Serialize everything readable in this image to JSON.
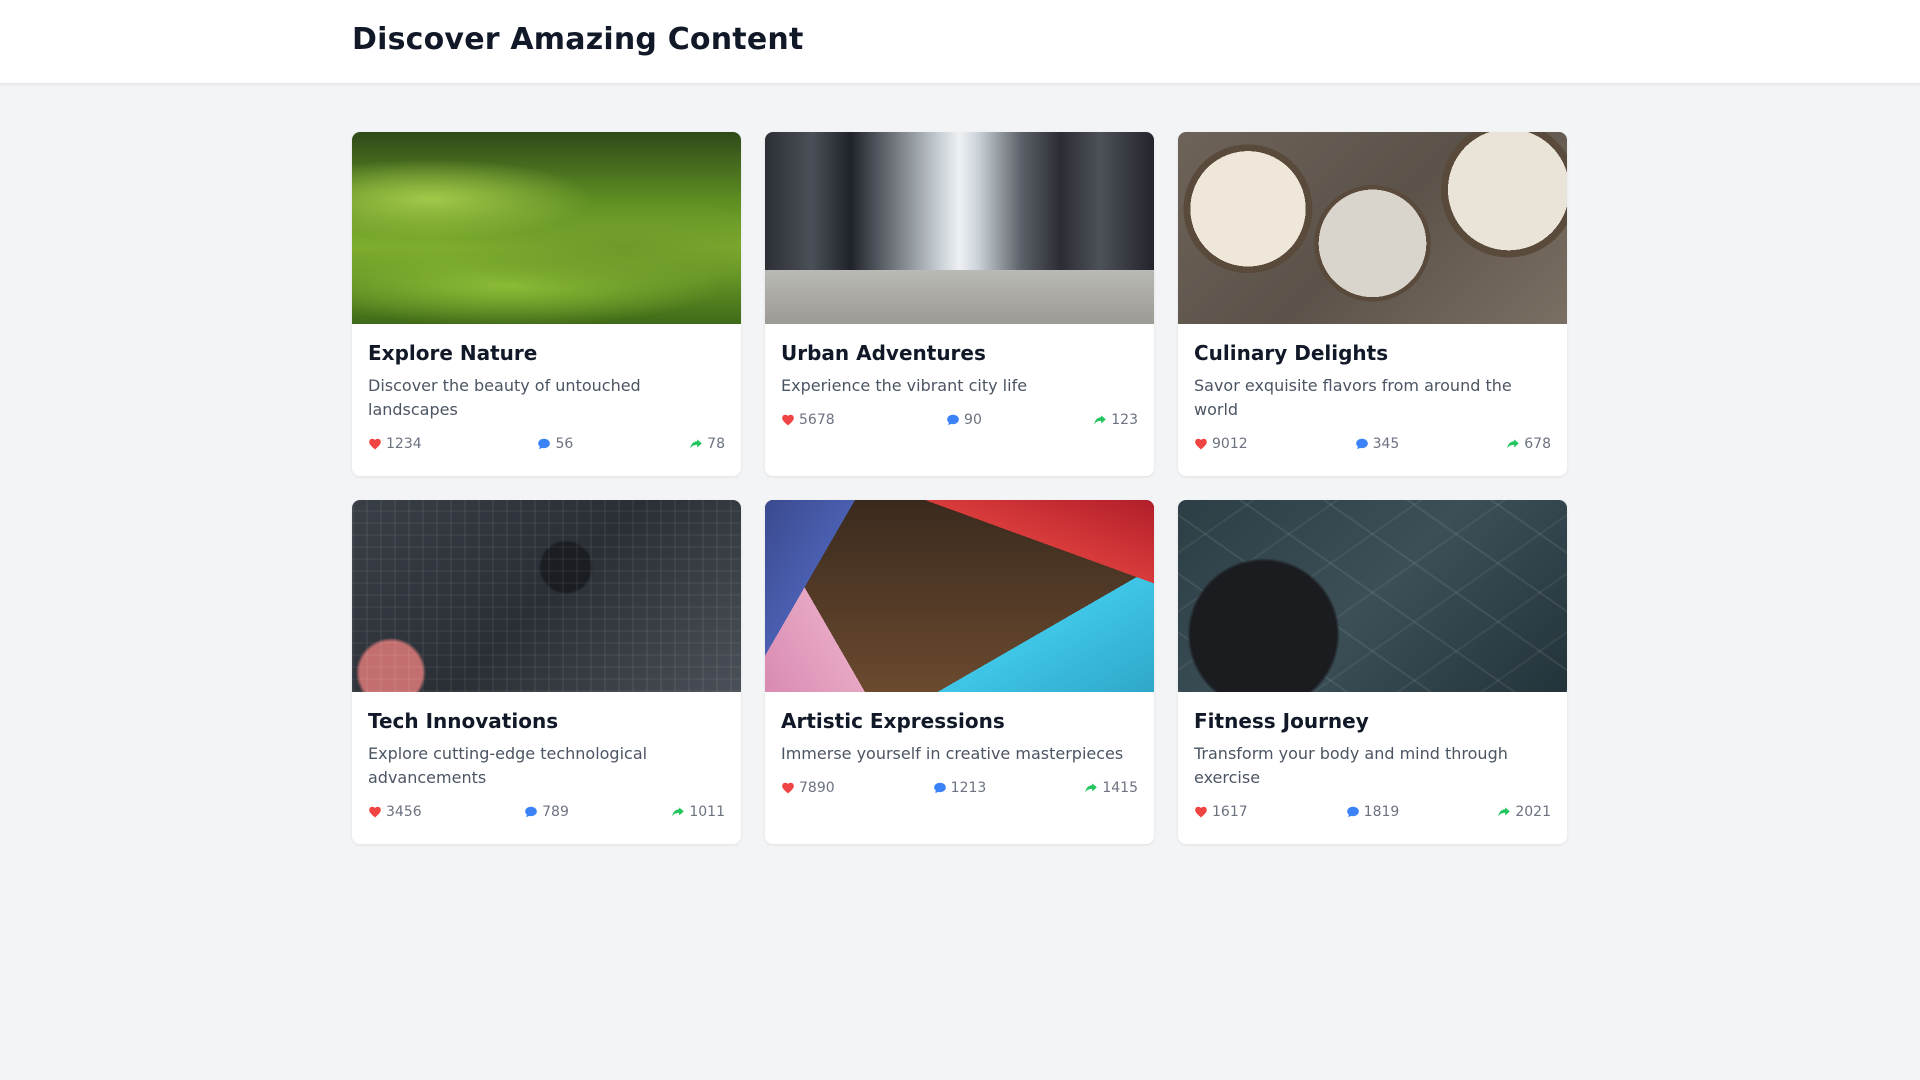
{
  "header": {
    "title": "Discover Amazing Content"
  },
  "cards": [
    {
      "title": "Explore Nature",
      "description": "Discover the beauty of untouched landscapes",
      "likes": "1234",
      "comments": "56",
      "shares": "78"
    },
    {
      "title": "Urban Adventures",
      "description": "Experience the vibrant city life",
      "likes": "5678",
      "comments": "90",
      "shares": "123"
    },
    {
      "title": "Culinary Delights",
      "description": "Savor exquisite flavors from around the world",
      "likes": "9012",
      "comments": "345",
      "shares": "678"
    },
    {
      "title": "Tech Innovations",
      "description": "Explore cutting-edge technological advancements",
      "likes": "3456",
      "comments": "789",
      "shares": "1011"
    },
    {
      "title": "Artistic Expressions",
      "description": "Immerse yourself in creative masterpieces",
      "likes": "7890",
      "comments": "1213",
      "shares": "1415"
    },
    {
      "title": "Fitness Journey",
      "description": "Transform your body and mind through exercise",
      "likes": "1617",
      "comments": "1819",
      "shares": "2021"
    }
  ],
  "icons": {
    "like": "heart-icon",
    "comment": "comment-icon",
    "share": "share-icon"
  },
  "colors": {
    "like": "#ef4444",
    "comment": "#3b82f6",
    "share": "#22c55e",
    "background": "#f3f4f6"
  }
}
